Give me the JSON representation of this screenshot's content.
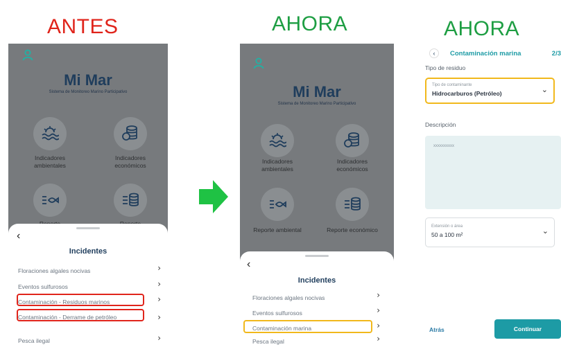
{
  "headings": {
    "before": "ANTES",
    "now_1": "AHORA",
    "now_2": "AHORA"
  },
  "colors": {
    "before": "#e0241b",
    "now": "#1e9e43",
    "accent": "#1d9ba5",
    "highlight_red": "#e0241b",
    "highlight_yellow": "#f1b81b"
  },
  "app": {
    "title": "Mi Mar",
    "subtitle": "Sistema de Monitoreo Marino Participativo",
    "indicators": [
      {
        "label": "Indicadores ambientales",
        "icon": "waves-sun-icon"
      },
      {
        "label": "Indicadores económicos",
        "icon": "coins-stack-icon"
      },
      {
        "label": "Reporte ambiental",
        "icon": "fish-list-icon"
      },
      {
        "label": "Reporte económico",
        "icon": "coins-list-icon"
      }
    ],
    "partial_labels": {
      "left": "Reporte",
      "right": "Reporte"
    }
  },
  "sheet_before": {
    "title": "Incidentes",
    "items": [
      "Floraciones algales nocivas",
      "Eventos sulfurosos",
      "Contaminación - Residuos marinos",
      "Contaminación - Derrame de petróleo",
      "Pesca ilegal"
    ]
  },
  "sheet_after": {
    "title": "Incidentes",
    "items": [
      "Floraciones algales nocivas",
      "Eventos sulfurosos",
      "Contaminación marina",
      "Pesca ilegal"
    ]
  },
  "form": {
    "back_icon": "chevron-left-icon",
    "title": "Contaminación marina",
    "step": "2/3",
    "waste_type_label": "Tipo de residuo",
    "pollutant_caption": "Tipo de contaminante",
    "pollutant_value": "Hidrocarburos (Petróleo)",
    "description_label": "Descripción",
    "description_placeholder": "xxxxxxxxxx",
    "area_caption": "Extensión o área",
    "area_value": "50 a 100 m²",
    "back_button": "Atrás",
    "continue_button": "Continuar"
  }
}
